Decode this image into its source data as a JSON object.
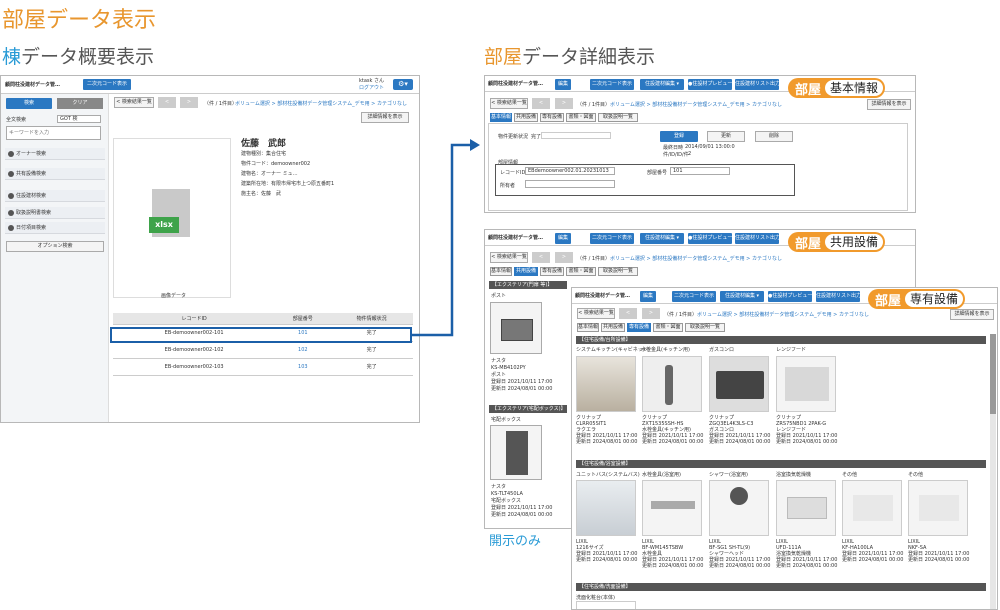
{
  "titles": {
    "main": "部屋データ表示",
    "building_prefix": "棟",
    "building_rest": "データ概要表示",
    "room_prefix": "部屋",
    "room_rest": "データ詳細表示",
    "disclosed_only": "開示のみ"
  },
  "header": {
    "app_title": "顧問柱没建材データ管…",
    "qr_button": "二次元コード表示",
    "user_line1": "ktask さん",
    "user_line2": "ログアウト",
    "detail_buttons": [
      "編集",
      "二次元コード表示",
      "住設建材編集 ▾",
      "●住設材プレビュー",
      "住設建材リスト出力"
    ]
  },
  "left": {
    "search_btn": "検索",
    "clear_btn": "クリア",
    "search_target_label": "全文検索",
    "select_value": "GOT 検",
    "keyword_placeholder": "キーワードを入力",
    "side_items": [
      "オーナー検索",
      "共有設備検索",
      "住設建材検索",
      "取扱説明書検索",
      "日付項目検索"
    ],
    "option_btn": "オプション検索",
    "back_btn": "< 検索結果一覧",
    "paging": "（件 / 1件目）",
    "breadcrumb": "ボリューム選択 > 部材柱設備材データ管理システム_デモ用 > カテゴリなし",
    "detail_info_btn": "詳細情報を表示",
    "owner_name": "佐藤　武郎",
    "owner_lines": [
      "建物種別：集合住宅",
      "物件コード：demoowner002",
      "建物名：オーナー ミュ…",
      "建築所在地：有限市帰宅市上つ原五番町1",
      "施主名：佐藤　武"
    ],
    "file_label": "xlsx",
    "file_caption": "画像データ",
    "table_headers": [
      "レコードID",
      "部屋番号",
      "物件情報状況"
    ],
    "table_rows": [
      [
        "EB-demoowner002-101",
        "101",
        "完了"
      ],
      [
        "EB-demoowner002-102",
        "102",
        "完了"
      ],
      [
        "EB-demoowner002-103",
        "103",
        "完了"
      ]
    ]
  },
  "window1": {
    "badge_prefix": "部屋",
    "badge_label": "基本情報",
    "tabs": [
      "基本情報",
      "共用設備",
      "専有設備",
      "書類・図面",
      "取扱説明一覧"
    ],
    "corner_btn": "詳細情報を表示",
    "row_label": "物件更新状況",
    "row_value": "完了",
    "action_btns": [
      "登録",
      "更新",
      "削除"
    ],
    "date_label": "最終日時",
    "date_value": "2014/09/01 13:00:0",
    "count_label": "件/ID/ID/件",
    "count_value": "2",
    "group_title": "部屋情報",
    "record_label": "レコードID",
    "record_value": "EBdemoowner002.01.20231013",
    "room_label": "部屋番号",
    "room_value": "101",
    "owner_label": "所有者"
  },
  "window2": {
    "badge_prefix": "部屋",
    "badge_label": "共用設備",
    "tabs": [
      "基本情報",
      "共用設備",
      "専有設備",
      "書類・図面",
      "取扱説明一覧"
    ],
    "section1": "【エクステリア(門扉 等)】",
    "section1_sub": "ポスト",
    "section2": "【エクステリア(宅配ボックス)】",
    "section2_sub": "宅配ボックス",
    "item1_lines": [
      "ナスタ",
      "KS-MB4102PY",
      "ポスト",
      "登録日 2021/10/11 17:00",
      "更新日 2024/08/01 00:00"
    ],
    "item2_lines": [
      "ナスタ",
      "KS-TLT450LA",
      "宅配ボックス",
      "登録日 2021/10/11 17:00",
      "更新日 2024/08/01 00:00"
    ]
  },
  "window3": {
    "badge_prefix": "部屋",
    "badge_label": "専有設備",
    "tabs": [
      "基本情報",
      "共用設備",
      "専有設備",
      "書類・図面",
      "取扱説明一覧"
    ],
    "corner_btn": "詳細情報を表示",
    "sec_kitchen": "【住宅設備/台所設備】",
    "kitchen_cols": [
      "システムキッチン(キャビネット)",
      "水栓金具(キッチン用)",
      "ガスコンロ",
      "レンジフード"
    ],
    "kitchen_caps": [
      [
        "クリナップ",
        "CLRR05SIT1",
        "ラクエラ",
        "登録日 2021/10/11 17:00",
        "更新日 2024/08/01 00:00"
      ],
      [
        "クリナップ",
        "ZXT1535SSH-HS",
        "水栓金具(キッチン用)",
        "登録日 2021/10/11 17:00",
        "更新日 2024/08/01 00:00"
      ],
      [
        "クリナップ",
        "ZGQ3EL4K3LS-C3",
        "ガスコンロ",
        "登録日 2021/10/11 17:00",
        "更新日 2024/08/01 00:00"
      ],
      [
        "クリナップ",
        "ZRS75NBD1 2PAK-G",
        "レンジフード",
        "登録日 2021/10/11 17:00",
        "更新日 2024/08/01 00:00"
      ]
    ],
    "sec_bath": "【住宅設備/浴室設備】",
    "bath_cols": [
      "ユニットバス(システムバス)",
      "水栓金具(浴室用)",
      "シャワー(浴室用)",
      "浴室換気乾燥機",
      "その他",
      "その他"
    ],
    "bath_caps": [
      [
        "LIXIL",
        "1216サイズ",
        "登録日 2021/10/11 17:00",
        "更新日 2024/08/01 00:00"
      ],
      [
        "LIXIL",
        "BF-WM145TSBW",
        "水栓金具",
        "登録日 2021/10/11 17:00",
        "更新日 2024/08/01 00:00"
      ],
      [
        "LIXIL",
        "BF-SG1 SH-TL(9)",
        "シャワーヘッド",
        "登録日 2021/10/11 17:00",
        "更新日 2024/08/01 00:00"
      ],
      [
        "LIXIL",
        "UFD-111A",
        "浴室換気乾燥機",
        "登録日 2021/10/11 17:00",
        "更新日 2024/08/01 00:00"
      ],
      [
        "LIXIL",
        "KF-HA100LA",
        "登録日 2021/10/11 17:00",
        "更新日 2024/08/01 00:00"
      ],
      [
        "LIXIL",
        "NKF-SA",
        "登録日 2021/10/11 17:00",
        "更新日 2024/08/01 00:00"
      ]
    ],
    "sec_wash": "【住宅設備/洗面設備】",
    "wash_sub": "洗面化粧台(本体)"
  },
  "colors": {
    "accent_orange": "#f19a2c",
    "brand_blue": "#2b78c2",
    "highlight_blue": "#2a9bd6"
  }
}
